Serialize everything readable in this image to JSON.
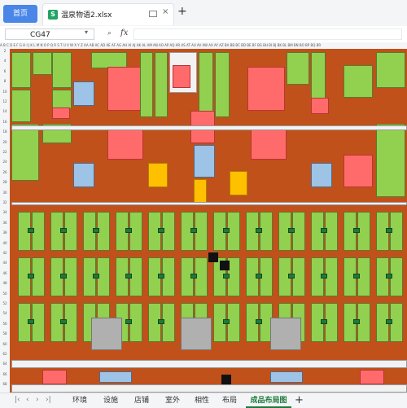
{
  "titlebar": {
    "home_label": "首页",
    "file_icon_letter": "S",
    "file_name": "温泉物语2.xlsx",
    "add_tab": "+"
  },
  "formula": {
    "cell_ref": "CG47",
    "fx_label": "fx"
  },
  "grid": {
    "column_labels": "A B C D E F G H I J K L M N O P Q R S T U V W X Y Z AA AB AC AD AE AF AG AH AI AJ AK AL AM AN AO AP AQ AR AS AT AU AV AW AX AY AZ BA BB BC BD BE BF BG BH BI BJ BK BL BM BN BO BP BQ BR",
    "row_labels": [
      "2",
      "4",
      "6",
      "8",
      "10",
      "12",
      "14",
      "16",
      "18",
      "20",
      "22",
      "24",
      "26",
      "28",
      "30",
      "32",
      "34",
      "36",
      "38",
      "40",
      "42",
      "44",
      "46",
      "48",
      "50",
      "52",
      "54",
      "56",
      "58",
      "60",
      "62",
      "64",
      "66",
      "68"
    ]
  },
  "sheets": {
    "tabs": [
      "环境",
      "设施",
      "店铺",
      "室外",
      "相性",
      "布局",
      "成品布局图"
    ],
    "active_index": 6,
    "add_label": "+"
  },
  "colors": {
    "map_background": "#c1511a",
    "grass": "#92d050",
    "pink": "#ff6b6b",
    "blue": "#9dc3e6",
    "yellow": "#ffc000",
    "accent": "#4a86e8",
    "active_sheet": "#1e7a3c"
  }
}
